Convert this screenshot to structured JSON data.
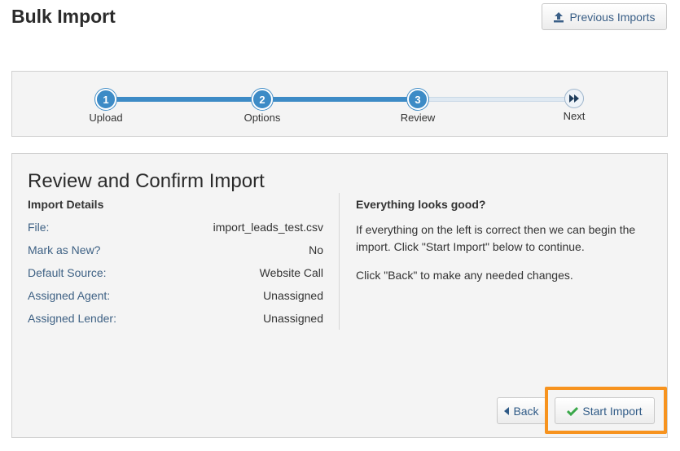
{
  "page": {
    "title": "Bulk Import"
  },
  "header": {
    "previous_imports_label": "Previous Imports"
  },
  "steps": [
    {
      "number": "1",
      "label": "Upload"
    },
    {
      "number": "2",
      "label": "Options"
    },
    {
      "number": "3",
      "label": "Review"
    },
    {
      "number": "",
      "label": "Next"
    }
  ],
  "review": {
    "title": "Review and Confirm Import",
    "details_heading": "Import Details",
    "details": [
      {
        "key": "File:",
        "value": "import_leads_test.csv"
      },
      {
        "key": "Mark as New?",
        "value": "No"
      },
      {
        "key": "Default Source:",
        "value": "Website Call"
      },
      {
        "key": "Assigned Agent:",
        "value": "Unassigned"
      },
      {
        "key": "Assigned Lender:",
        "value": "Unassigned"
      }
    ],
    "confirm_heading": "Everything looks good?",
    "confirm_text": "If everything on the left is correct then we can begin the import. Click \"Start Import\" below to continue.",
    "back_hint": "Click \"Back\" to make any needed changes."
  },
  "actions": {
    "back_label": "Back",
    "start_label": "Start Import"
  },
  "colors": {
    "accent": "#3d8bc6",
    "highlight": "#f7931e",
    "check": "#3aa84a",
    "link": "#3e6184"
  },
  "icons": {
    "previous_imports": "upload-icon",
    "next_step": "fast-forward-icon",
    "back": "caret-left-icon",
    "start": "check-icon"
  }
}
